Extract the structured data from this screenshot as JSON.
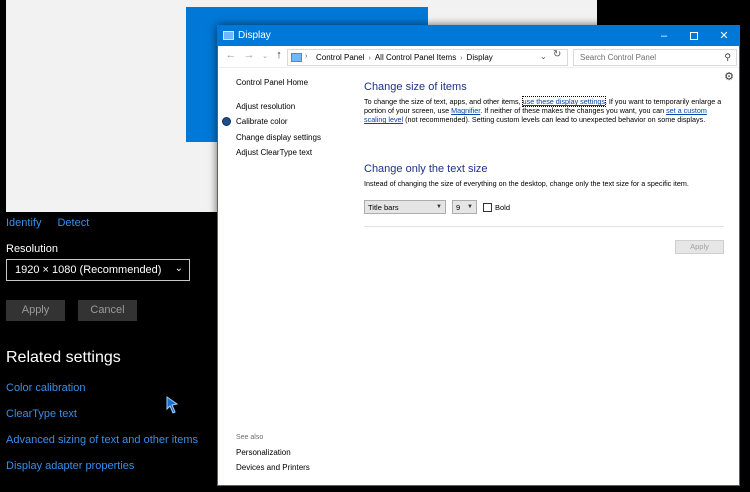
{
  "settings": {
    "links": [
      "Identify",
      "Detect"
    ],
    "resolution_label": "Resolution",
    "resolution_value": "1920 × 1080 (Recommended)",
    "apply_label": "Apply",
    "cancel_label": "Cancel",
    "related_title": "Related settings",
    "related_links": [
      "Color calibration",
      "ClearType text",
      "Advanced sizing of text and other items",
      "Display adapter properties"
    ],
    "accent_color": "#0078d7"
  },
  "window": {
    "title": "Display",
    "controls": {
      "minimize": "–",
      "close": "✕"
    },
    "address": {
      "segments": [
        "Control Panel",
        "All Control Panel Items",
        "Display"
      ]
    },
    "search_placeholder": "Search Control Panel",
    "sidebar": {
      "home": "Control Panel Home",
      "items": [
        "Adjust resolution",
        "Calibrate color",
        "Change display settings",
        "Adjust ClearType text"
      ],
      "see_also": "See also",
      "bottom_links": [
        "Personalization",
        "Devices and Printers"
      ]
    },
    "main": {
      "heading1": "Change size of items",
      "para1_a": "To change the size of text, apps, and other items, ",
      "para1_link1": "use these display settings",
      "para1_b": ".  If you want to temporarily enlarge a portion of your screen, use ",
      "para1_link2": "Magnifier",
      "para1_c": ".  If neither of these makes the changes you want, you can ",
      "para1_link3": "set a custom scaling level",
      "para1_d": " (not recommended).  Setting custom levels can lead to unexpected behavior on some displays.",
      "heading2": "Change only the text size",
      "para2": "Instead of changing the size of everything on the desktop, change only the text size for a specific item.",
      "item_select": "Title bars",
      "size_select": "9",
      "bold_label": "Bold",
      "apply_label": "Apply"
    }
  }
}
